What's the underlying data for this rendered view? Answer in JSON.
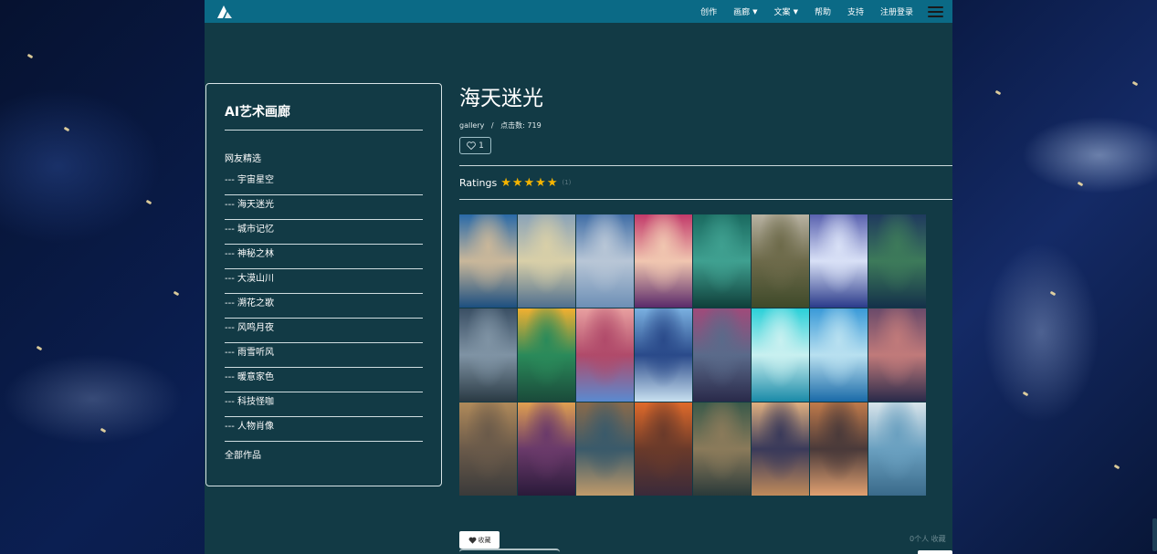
{
  "header": {
    "nav": [
      {
        "label": "创作",
        "has_caret": false
      },
      {
        "label": "画廊",
        "has_caret": true
      },
      {
        "label": "文案",
        "has_caret": true
      },
      {
        "label": "帮助",
        "has_caret": false
      },
      {
        "label": "支持",
        "has_caret": false
      },
      {
        "label": "注册登录",
        "has_caret": false
      }
    ]
  },
  "sidebar": {
    "title": "AI艺术画廊",
    "section": "网友精选",
    "items": [
      {
        "label": "--- 宇宙星空"
      },
      {
        "label": "--- 海天迷光"
      },
      {
        "label": "--- 城市记忆"
      },
      {
        "label": "--- 神秘之林"
      },
      {
        "label": "--- 大漠山川"
      },
      {
        "label": "--- 溯花之歌"
      },
      {
        "label": "--- 风鸣月夜"
      },
      {
        "label": "--- 雨雪听风"
      },
      {
        "label": "--- 暖意家色"
      },
      {
        "label": "--- 科技怪咖"
      },
      {
        "label": "--- 人物肖像"
      }
    ],
    "all": "全部作品"
  },
  "main": {
    "title": "海天迷光",
    "breadcrumb": "gallery",
    "separator": "/",
    "views_label": "点击数:",
    "views": "719",
    "likes": "1",
    "ratings_label": "Ratings",
    "stars": 5,
    "rating_count": "(1)"
  },
  "gallery": [
    {
      "colors": [
        "#2a6aa8",
        "#c9b79a",
        "#1c4f80"
      ]
    },
    {
      "colors": [
        "#8aa3b8",
        "#d8cfa8",
        "#4f6f8f"
      ]
    },
    {
      "colors": [
        "#3f6da6",
        "#b8c6d6",
        "#6d8fb6"
      ]
    },
    {
      "colors": [
        "#c23a6a",
        "#f0c6b0",
        "#5a2a6a"
      ]
    },
    {
      "colors": [
        "#1a6a60",
        "#3fa090",
        "#0f3f3a"
      ]
    },
    {
      "colors": [
        "#b8b2a2",
        "#6d6a4a",
        "#3f4a2a"
      ]
    },
    {
      "colors": [
        "#5a62b0",
        "#d8e0f6",
        "#2a3a8a"
      ]
    },
    {
      "colors": [
        "#1f3a5e",
        "#3d7a5a",
        "#14314a"
      ]
    },
    {
      "colors": [
        "#3a4f64",
        "#7f93a4",
        "#2a3a44"
      ]
    },
    {
      "colors": [
        "#f2b030",
        "#2a8a5a",
        "#1a4a3a"
      ]
    },
    {
      "colors": [
        "#e8a0a0",
        "#b04a6a",
        "#5a8ad0"
      ]
    },
    {
      "colors": [
        "#7ab0e0",
        "#2a4a8a",
        "#c8e0f0"
      ]
    },
    {
      "colors": [
        "#a04a7a",
        "#5a6a8a",
        "#2a2a4a"
      ]
    },
    {
      "colors": [
        "#2ad0d8",
        "#c8f0f0",
        "#1a8aa8"
      ]
    },
    {
      "colors": [
        "#3a9ad8",
        "#b8e0f0",
        "#1a6aa8"
      ]
    },
    {
      "colors": [
        "#6a4a6a",
        "#c07a7a",
        "#2a2a4a"
      ]
    },
    {
      "colors": [
        "#b08a5a",
        "#6a5a4a",
        "#3a3a3a"
      ]
    },
    {
      "colors": [
        "#e0a050",
        "#6a3a6a",
        "#2a1a3a"
      ]
    },
    {
      "colors": [
        "#8a6a4a",
        "#3a5a6a",
        "#c09a6a"
      ]
    },
    {
      "colors": [
        "#e06a2a",
        "#6a3a2a",
        "#3a2a3a"
      ]
    },
    {
      "colors": [
        "#3a5a4a",
        "#8a7a5a",
        "#2a3a3a"
      ]
    },
    {
      "colors": [
        "#e0b080",
        "#3a3a5a",
        "#c08a5a"
      ]
    },
    {
      "colors": [
        "#c07a4a",
        "#4a3a3a",
        "#e0a070"
      ]
    },
    {
      "colors": [
        "#d8e4ea",
        "#6aa0c0",
        "#3a6a8a"
      ]
    }
  ],
  "footer": {
    "favorite_label": "收藏",
    "favorite_count": "0个人 收藏"
  },
  "colors": {
    "topbar": "#0b6a86",
    "page_bg": "#123a45",
    "star": "#f5b400"
  }
}
